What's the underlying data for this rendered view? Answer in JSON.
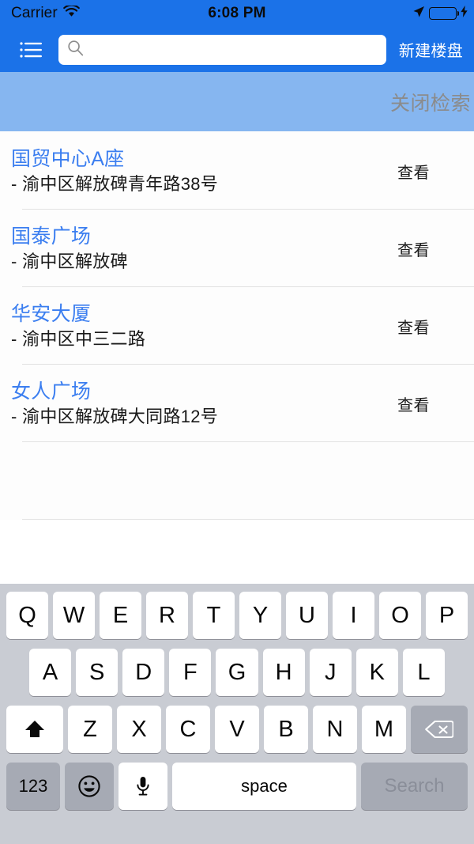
{
  "status_bar": {
    "carrier": "Carrier",
    "wifi_icon": "wifi-icon",
    "time": "6:08 PM",
    "location_icon": "location-arrow-icon",
    "battery_icon": "battery-icon",
    "charging_icon": "lightning-bolt-icon",
    "battery_color": "#4CD964"
  },
  "nav_bar": {
    "menu_icon": "list-menu-icon",
    "search": {
      "icon": "search-icon",
      "value": "",
      "placeholder": ""
    },
    "right_button": "新建楼盘",
    "background_color": "#1B72E8"
  },
  "sub_bar": {
    "close_search_label": "关闭检索",
    "background_color": "#86B6F0",
    "text_color": "#8b8b8b"
  },
  "list": {
    "action_label": "查看",
    "title_color": "#3b7ef0",
    "items": [
      {
        "title": "国贸中心A座",
        "address": "- 渝中区解放碑青年路38号",
        "action": "查看"
      },
      {
        "title": "国泰广场",
        "address": "- 渝中区解放碑",
        "action": "查看"
      },
      {
        "title": "华安大厦",
        "address": "- 渝中区中三二路",
        "action": "查看"
      },
      {
        "title": "女人广场",
        "address": "- 渝中区解放碑大同路12号",
        "action": "查看"
      }
    ]
  },
  "keyboard": {
    "row1": [
      "Q",
      "W",
      "E",
      "R",
      "T",
      "Y",
      "U",
      "I",
      "O",
      "P"
    ],
    "row2": [
      "A",
      "S",
      "D",
      "F",
      "G",
      "H",
      "J",
      "K",
      "L"
    ],
    "row3": [
      "Z",
      "X",
      "C",
      "V",
      "B",
      "N",
      "M"
    ],
    "shift_icon": "shift-arrow-icon",
    "delete_icon": "backspace-icon",
    "numbers_key": "123",
    "emoji_icon": "smiley-face-icon",
    "mic_icon": "microphone-icon",
    "space_key": "space",
    "return_key": "Search",
    "background_color": "#C9CCD3"
  }
}
